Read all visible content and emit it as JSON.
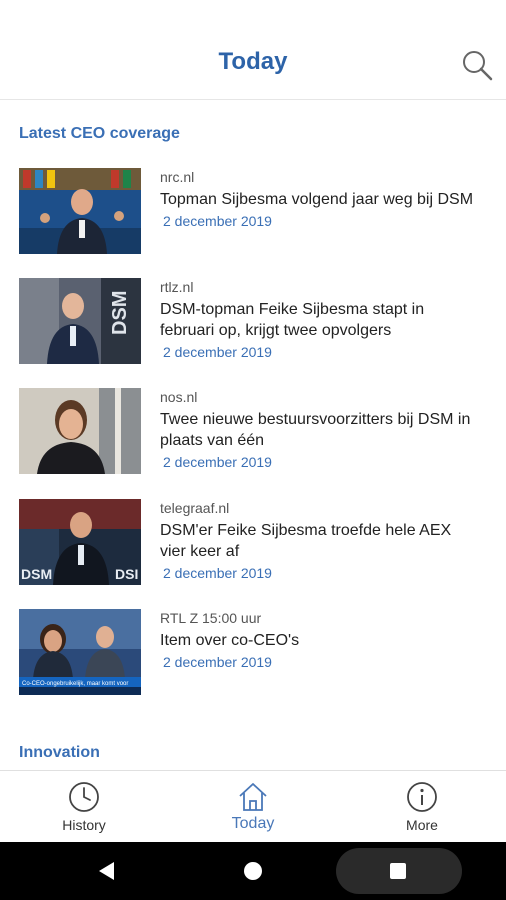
{
  "header": {
    "title": "Today",
    "search_icon": "search-icon"
  },
  "sections": {
    "ceo": {
      "title": "Latest CEO coverage"
    },
    "innovation": {
      "title": "Innovation"
    }
  },
  "articles": [
    {
      "source": "nrc.nl",
      "headline": "Topman Sijbesma volgend jaar weg bij DSM",
      "date": "2 december 2019"
    },
    {
      "source": "rtlz.nl",
      "headline": "DSM-topman Feike Sijbesma stapt in februari op, krijgt twee opvolgers",
      "date": "2 december 2019"
    },
    {
      "source": "nos.nl",
      "headline": "Twee nieuwe bestuursvoorzitters bij DSM in plaats van één",
      "date": "2 december 2019"
    },
    {
      "source": "telegraaf.nl",
      "headline": "DSM'er Feike Sijbesma troefde hele AEX vier keer af",
      "date": "2 december 2019"
    },
    {
      "source": "RTL Z 15:00 uur",
      "headline": "Item over co-CEO's",
      "date": "2 december 2019"
    }
  ],
  "thumb_text": {
    "dsm": "DSM",
    "dsm_short": "DSI",
    "caption": "Co-CEO-ongebruikelijk, maar komt voor"
  },
  "nav": {
    "history": "History",
    "today": "Today",
    "more": "More"
  },
  "colors": {
    "accent": "#2d63a8",
    "link": "#3a6fb5"
  }
}
